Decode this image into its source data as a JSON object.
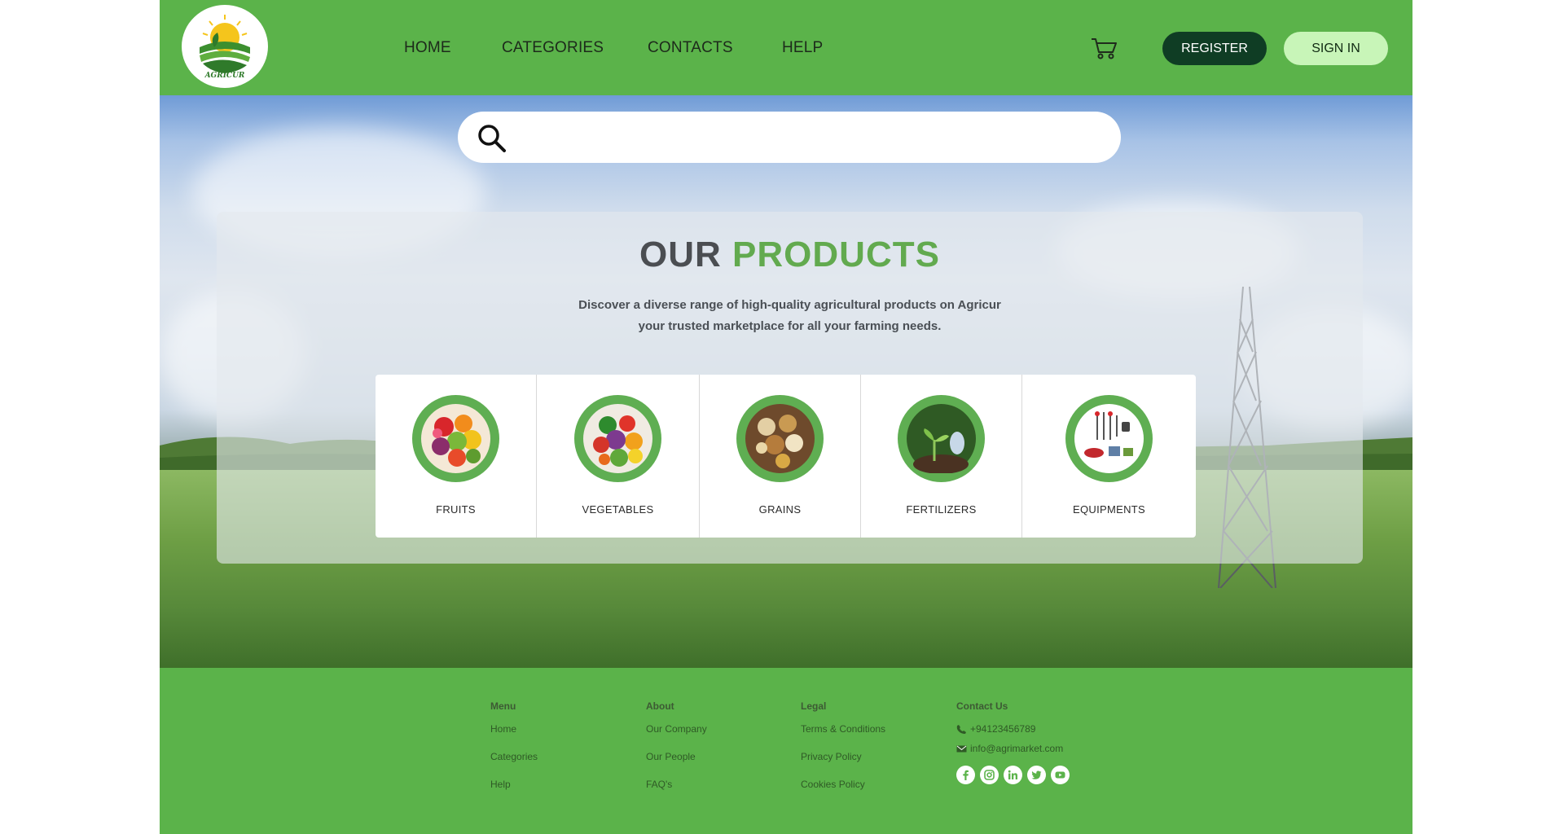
{
  "brand": {
    "logo_text": "AGRICUR"
  },
  "nav": {
    "items": [
      {
        "label": "HOME"
      },
      {
        "label": "CATEGORIES"
      },
      {
        "label": "CONTACTS"
      },
      {
        "label": "HELP"
      }
    ],
    "cart_icon": "cart-icon",
    "register_label": "REGISTER",
    "signin_label": "SIGN IN"
  },
  "search": {
    "placeholder": "",
    "value": "",
    "icon": "search-icon"
  },
  "products": {
    "title_part1": "OUR",
    "title_part2": "PRODUCTS",
    "description_line1": "Discover a diverse range of high-quality agricultural products on Agricur",
    "description_line2": "your trusted marketplace for all your farming needs.",
    "categories": [
      {
        "label": "FRUITS",
        "icon": "fruits-image"
      },
      {
        "label": "VEGETABLES",
        "icon": "vegetables-image"
      },
      {
        "label": "GRAINS",
        "icon": "grains-image"
      },
      {
        "label": "FERTILIZERS",
        "icon": "fertilizers-image"
      },
      {
        "label": "EQUIPMENTS",
        "icon": "equipments-image"
      }
    ]
  },
  "footer": {
    "menu": {
      "heading": "Menu",
      "links": [
        "Home",
        "Categories",
        "Help"
      ]
    },
    "about": {
      "heading": "About",
      "links": [
        "Our Company",
        "Our People",
        "FAQ's"
      ]
    },
    "legal": {
      "heading": "Legal",
      "links": [
        "Terms & Conditions",
        "Privacy Policy",
        "Cookies Policy"
      ]
    },
    "contact": {
      "heading": "Contact Us",
      "phone": "+94123456789",
      "email": "info@agrimarket.com",
      "socials": [
        "facebook-icon",
        "instagram-icon",
        "linkedin-icon",
        "twitter-icon",
        "youtube-icon"
      ]
    }
  },
  "colors": {
    "brand_green": "#5bb34a",
    "dark_green": "#0f3d24",
    "light_green": "#c8f5b8",
    "accent_title": "#62aa4f"
  }
}
